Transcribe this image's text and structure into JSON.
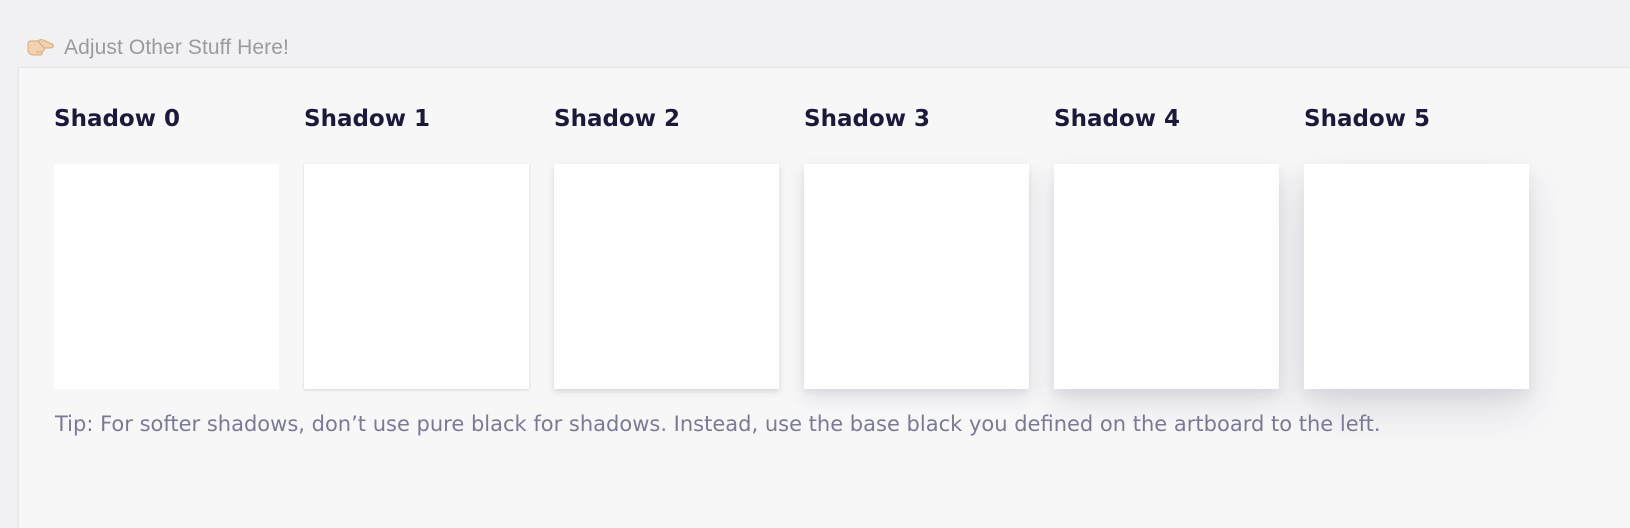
{
  "header": {
    "icon": "pointing-hand-icon",
    "title": "Adjust Other Stuff Here!"
  },
  "artboard": {
    "cards": [
      {
        "label": "Shadow 0",
        "shadow_level": 0
      },
      {
        "label": "Shadow 1",
        "shadow_level": 1
      },
      {
        "label": "Shadow 2",
        "shadow_level": 2
      },
      {
        "label": "Shadow 3",
        "shadow_level": 3
      },
      {
        "label": "Shadow 4",
        "shadow_level": 4
      },
      {
        "label": "Shadow 5",
        "shadow_level": 5
      }
    ],
    "tip": "Tip: For softer shadows, don’t use pure black for shadows. Instead, use the base black you defined on the artboard to the left."
  },
  "colors": {
    "page_background": "#f1f1f3",
    "artboard_background": "#f7f7f8",
    "card_background": "#ffffff",
    "label_text": "#1b1a3a",
    "tip_text": "#7b7a95",
    "header_text": "#9b9b9f"
  }
}
